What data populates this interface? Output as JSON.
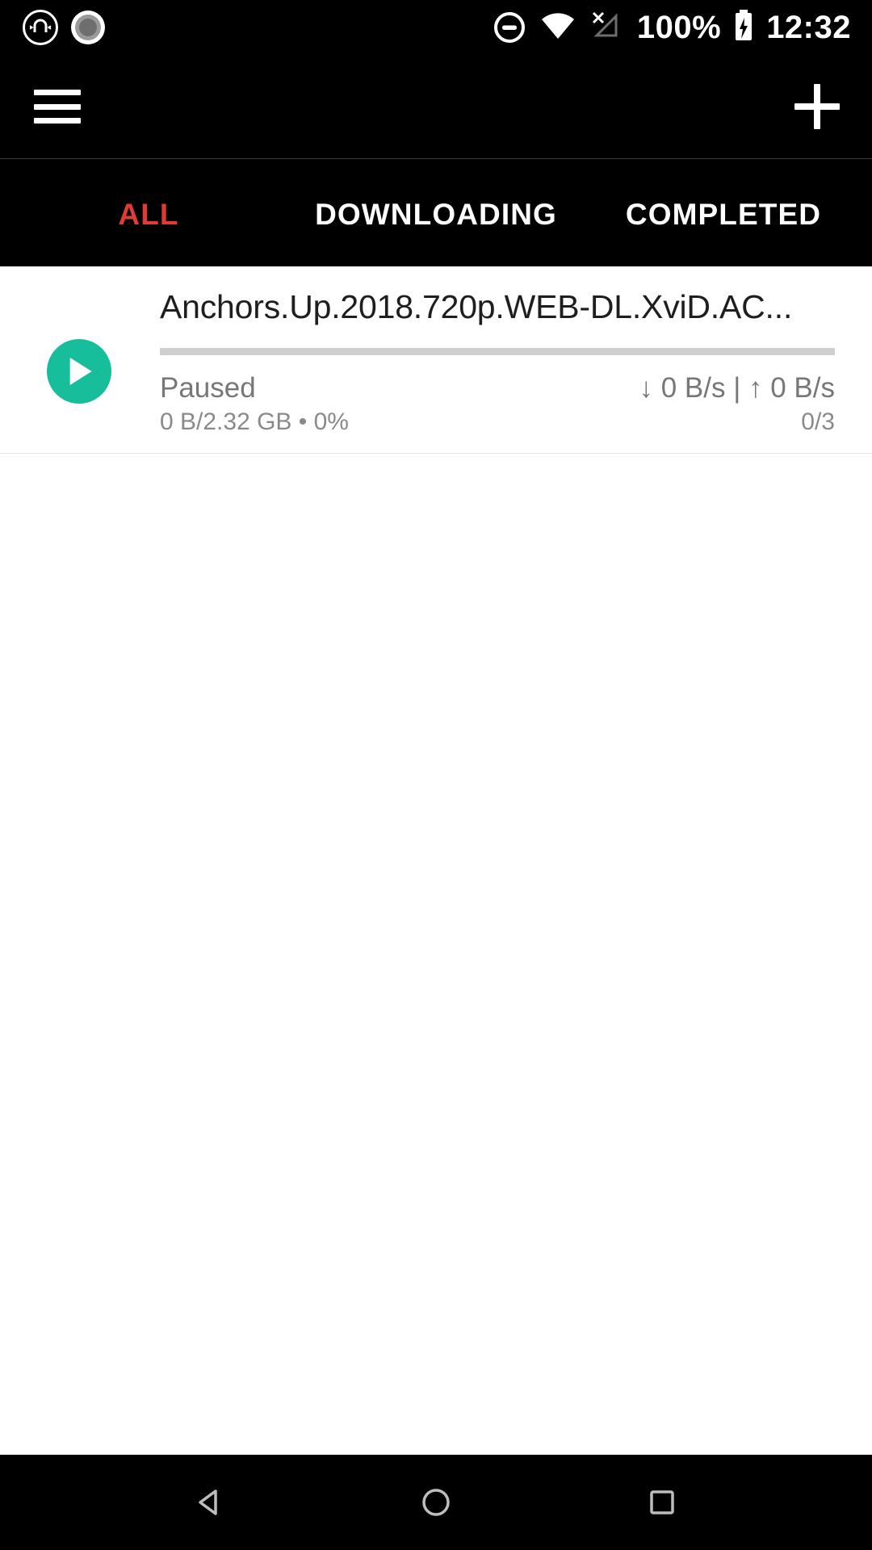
{
  "status_bar": {
    "icons_left": [
      "magnet-circle-icon",
      "screen-record-icon"
    ],
    "dnd_icon": "do-not-disturb-icon",
    "wifi_icon": "wifi-full-icon",
    "cell_icon": "cellular-no-sim-icon",
    "battery_percent": "100%",
    "battery_icon": "battery-charging-icon",
    "clock": "12:32"
  },
  "app_bar": {
    "menu_icon": "hamburger-menu-icon",
    "add_icon": "plus-add-icon"
  },
  "tabs": [
    {
      "label": "ALL",
      "active": true
    },
    {
      "label": "DOWNLOADING",
      "active": false
    },
    {
      "label": "COMPLETED",
      "active": false
    }
  ],
  "colors": {
    "accent_active_tab": "#e03b34",
    "accent_green": "#17BE9B",
    "app_bar_bg": "#000000",
    "list_bg": "#ffffff",
    "progress_track": "#cfcfcf"
  },
  "downloads": [
    {
      "title": "Anchors.Up.2018.720p.WEB-DL.XviD.AC...",
      "action_icon": "play-resume-icon",
      "status": "Paused",
      "size_progress": "0 B/2.32 GB • 0%",
      "progress_percent": 0,
      "speeds": "↓ 0 B/s | ↑ 0 B/s",
      "peers": "0/3"
    }
  ],
  "nav_bar": {
    "back": "back-triangle-icon",
    "home": "home-circle-icon",
    "recents": "recents-square-icon"
  }
}
